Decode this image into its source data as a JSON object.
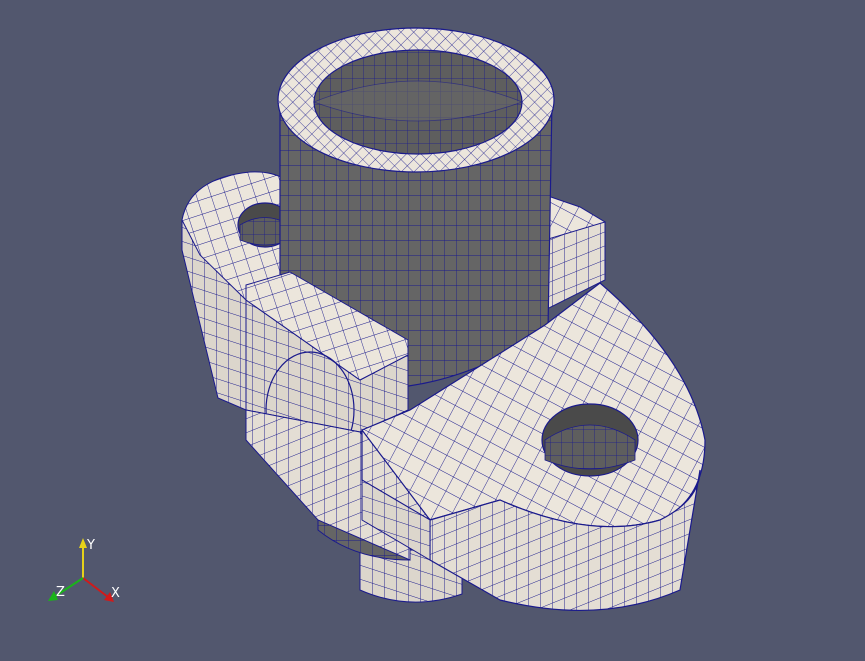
{
  "colors": {
    "background": "#52576e",
    "surface_light": "#ece6dc",
    "surface_dark": "#656565",
    "surface_mid": "#8a8680",
    "mesh_edges": "#1a1a8c",
    "axis_x": "#d11a1a",
    "axis_y": "#e6d21a",
    "axis_z": "#1ab41a",
    "axis_label": "#ffffff"
  },
  "orientation_axes": {
    "x_label": "X",
    "y_label": "Y",
    "z_label": "Z"
  },
  "model": {
    "icon": "hex-mesh-bracket-icon"
  }
}
